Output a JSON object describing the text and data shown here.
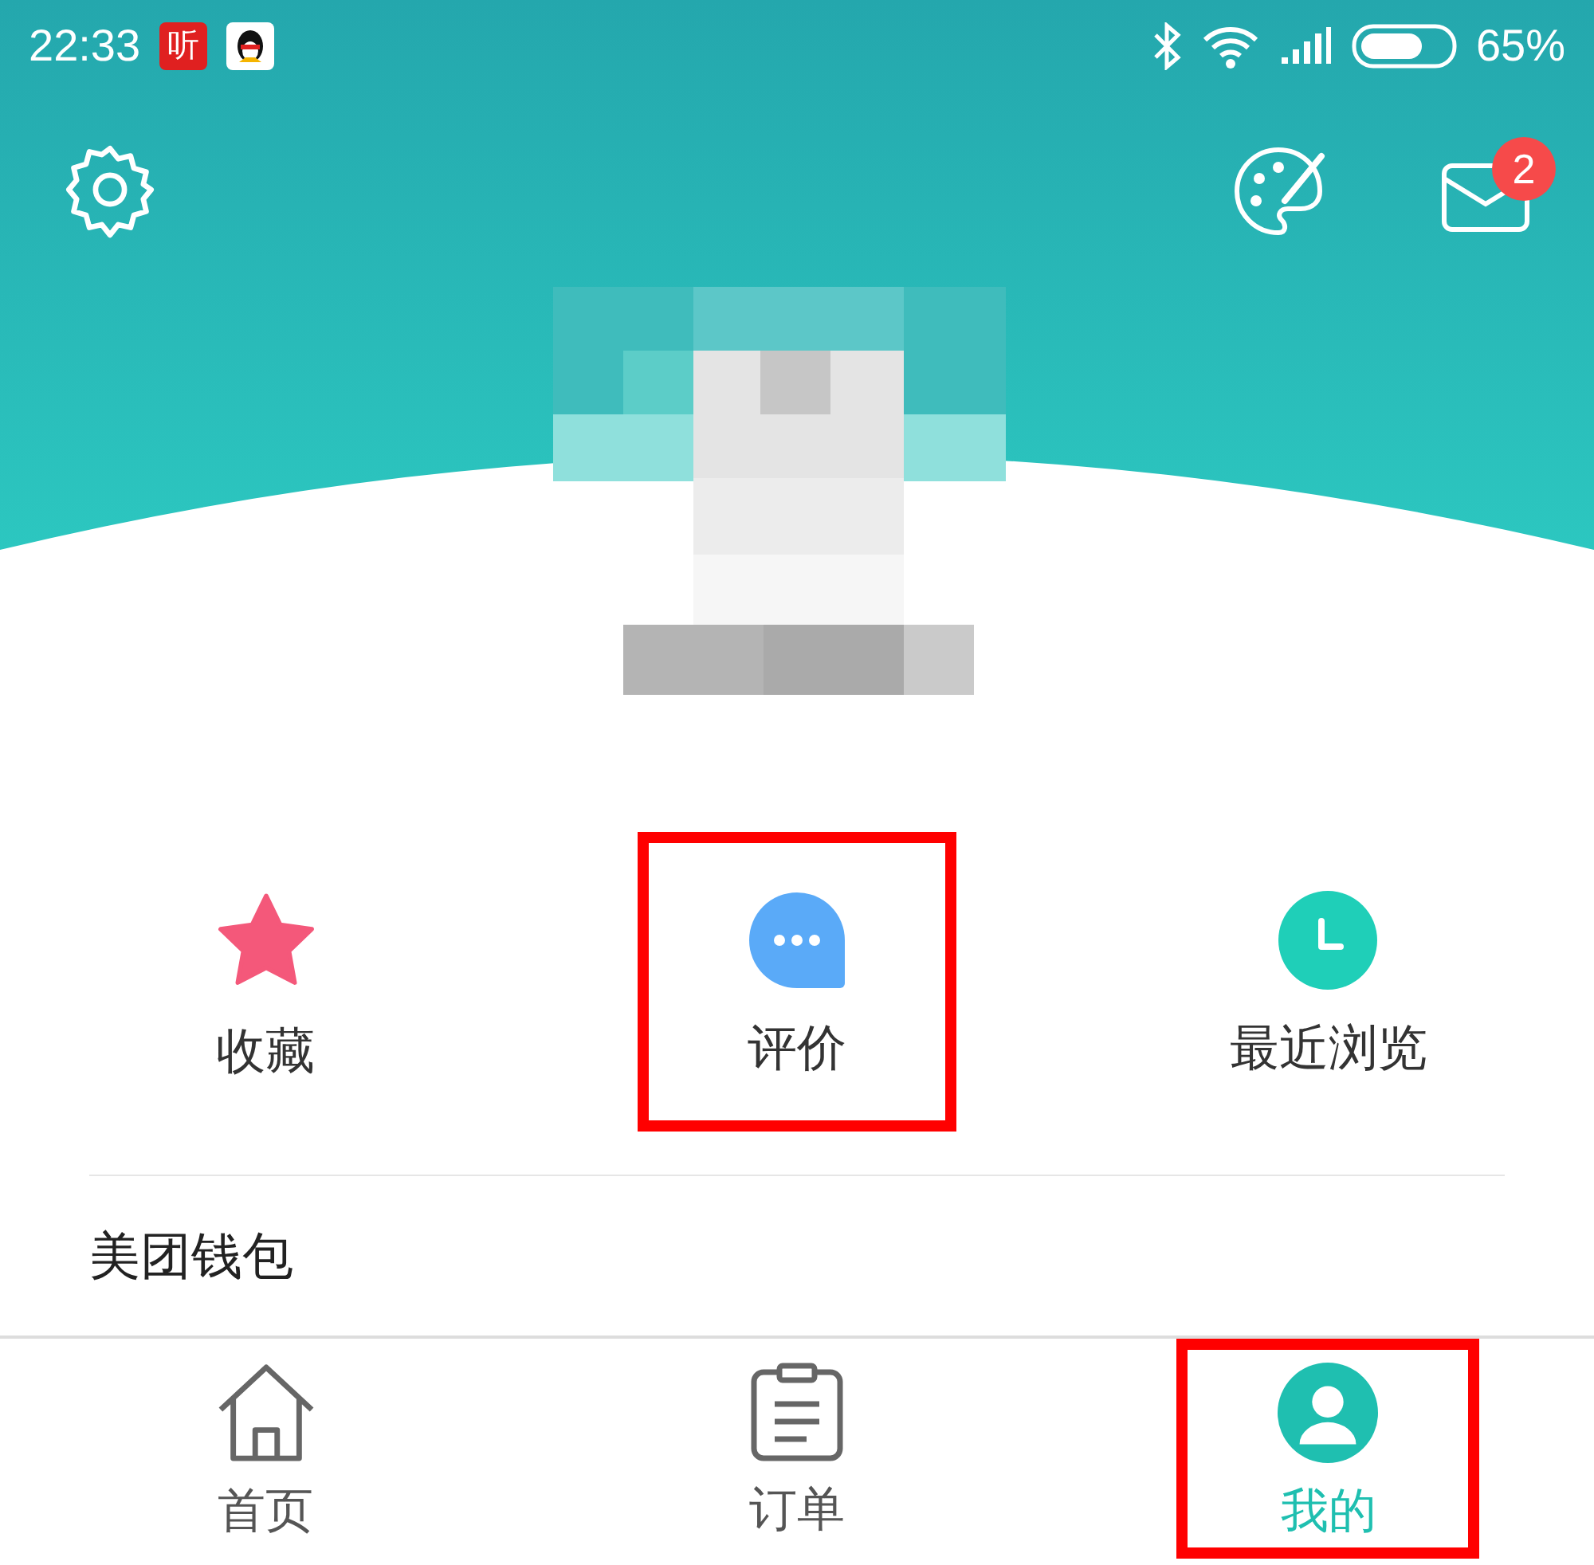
{
  "status_bar": {
    "time": "22:33",
    "app_icons": [
      {
        "kind": "text",
        "label": "听"
      },
      {
        "kind": "penguin"
      }
    ],
    "battery": "65%"
  },
  "header": {
    "message_badge": "2"
  },
  "quick_actions": [
    {
      "kind": "star",
      "label": "收藏",
      "highlighted": false
    },
    {
      "kind": "chat",
      "label": "评价",
      "highlighted": true
    },
    {
      "kind": "clock",
      "label": "最近浏览",
      "highlighted": false
    }
  ],
  "section_title": "美团钱包",
  "bottom_nav": [
    {
      "kind": "home",
      "label": "首页",
      "selected": false,
      "highlighted": false
    },
    {
      "kind": "orders",
      "label": "订单",
      "selected": false,
      "highlighted": false
    },
    {
      "kind": "profile",
      "label": "我的",
      "selected": true,
      "highlighted": true
    }
  ]
}
